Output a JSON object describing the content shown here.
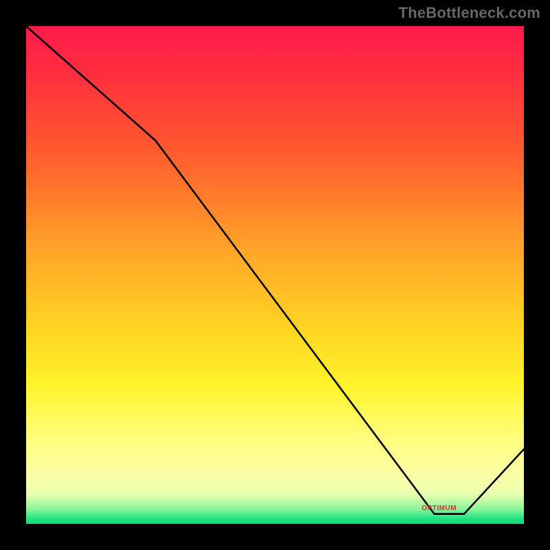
{
  "watermark": "TheBottleneck.com",
  "minimum_label": "OPTIMUM",
  "chart_data": {
    "type": "line",
    "title": "",
    "xlabel": "",
    "ylabel": "",
    "x_range_fraction": [
      0.0,
      1.0
    ],
    "y_range_fraction": [
      0.0,
      1.0
    ],
    "series": [
      {
        "name": "bottleneck-curve",
        "points": [
          {
            "x": 0.0,
            "y": 1.0
          },
          {
            "x": 0.26,
            "y": 0.77
          },
          {
            "x": 0.82,
            "y": 0.02
          },
          {
            "x": 0.88,
            "y": 0.02
          },
          {
            "x": 1.0,
            "y": 0.15
          }
        ]
      }
    ],
    "gradient_stops": [
      {
        "pos": 0.0,
        "color": "#ff1a4a"
      },
      {
        "pos": 0.45,
        "color": "#ffa529"
      },
      {
        "pos": 0.75,
        "color": "#fff32a"
      },
      {
        "pos": 0.97,
        "color": "#8cf59a"
      },
      {
        "pos": 1.0,
        "color": "#15d877"
      }
    ],
    "minimum_marker": {
      "x_fraction": 0.85,
      "y_fraction": 0.02
    }
  }
}
